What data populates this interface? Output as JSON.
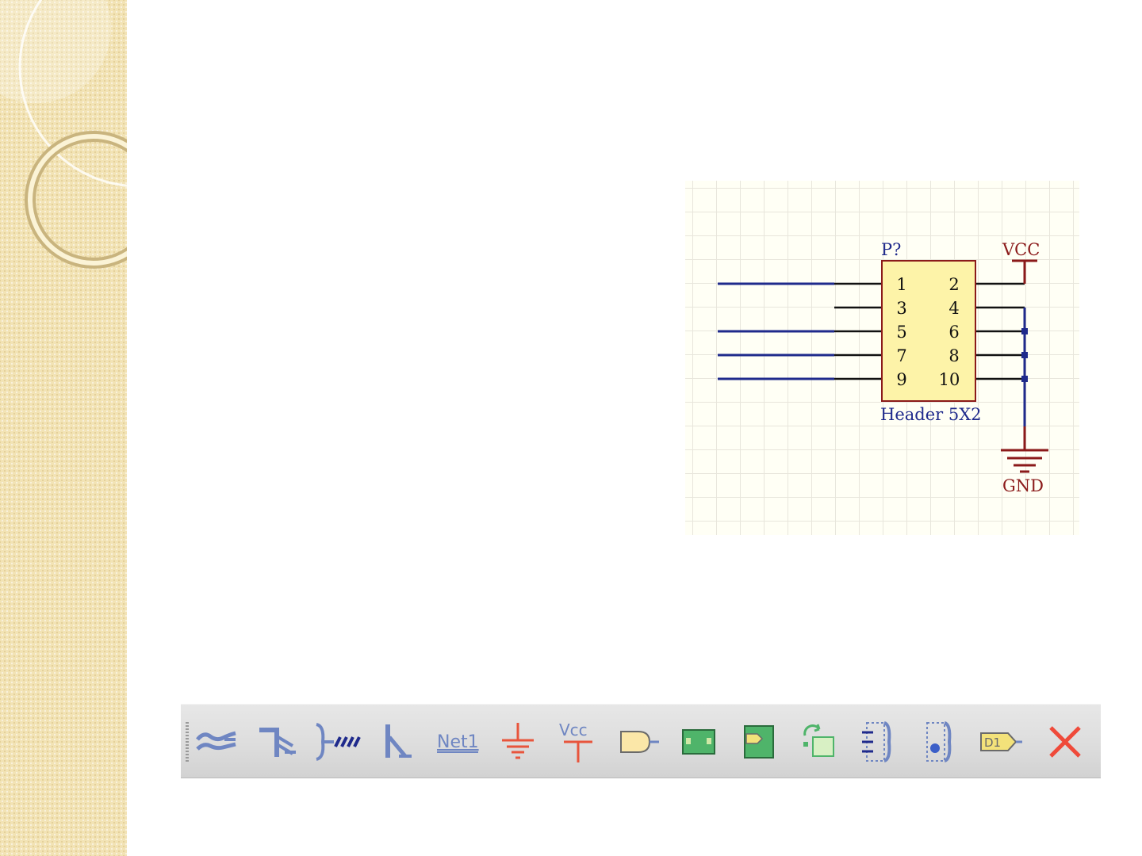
{
  "colors": {
    "sidebar_bg": "#f2e3b5",
    "net_blue": "#1f2a8c",
    "power_red": "#8b1a1a",
    "component_fill": "#fdf3a8",
    "component_stroke": "#8b1a1a",
    "toolbar_icon_blue": "#6f86c2"
  },
  "schematic": {
    "designator": "P?",
    "component_name": "Header 5X2",
    "power_label": "VCC",
    "ground_label": "GND",
    "pins_left": [
      "1",
      "3",
      "5",
      "7",
      "9"
    ],
    "pins_right": [
      "2",
      "4",
      "6",
      "8",
      "10"
    ]
  },
  "toolbar": {
    "buttons": [
      {
        "name": "place-bus-icon",
        "label": ""
      },
      {
        "name": "place-bus-entry-icon",
        "label": ""
      },
      {
        "name": "place-wire-harness-icon",
        "label": ""
      },
      {
        "name": "place-wire-icon",
        "label": ""
      },
      {
        "name": "place-net-label-icon",
        "label": "Net1"
      },
      {
        "name": "gnd-power-port-icon",
        "label": ""
      },
      {
        "name": "vcc-power-port-icon",
        "label": "Vcc"
      },
      {
        "name": "place-part-icon",
        "label": ""
      },
      {
        "name": "place-sheet-symbol-icon",
        "label": ""
      },
      {
        "name": "place-sheet-entry-icon",
        "label": ""
      },
      {
        "name": "place-device-sheet-icon",
        "label": ""
      },
      {
        "name": "place-harness-connector-icon",
        "label": ""
      },
      {
        "name": "place-harness-entry-icon",
        "label": ""
      },
      {
        "name": "place-port-icon",
        "label": "D1"
      },
      {
        "name": "place-no-erc-icon",
        "label": ""
      }
    ]
  }
}
